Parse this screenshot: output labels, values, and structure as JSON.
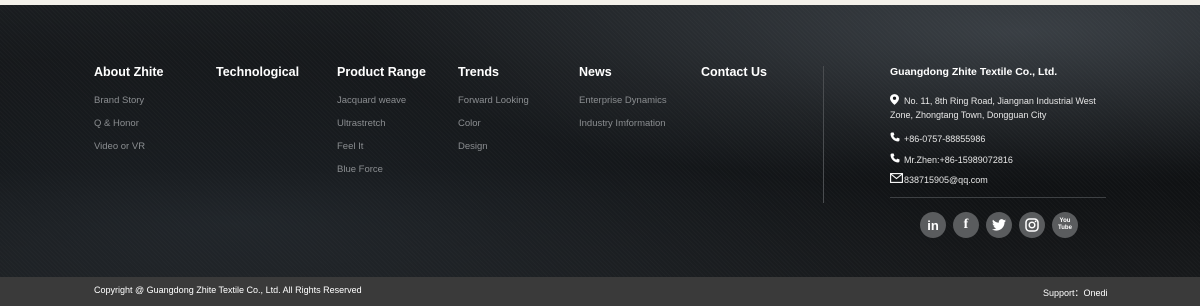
{
  "columns": [
    {
      "title": "About Zhite",
      "items": [
        "Brand Story",
        "Q & Honor",
        "Video or VR"
      ]
    },
    {
      "title": "Technological",
      "items": []
    },
    {
      "title": "Product Range",
      "items": [
        "Jacquard weave",
        "Ultrastretch",
        "Feel It",
        "Blue Force"
      ]
    },
    {
      "title": "Trends",
      "items": [
        "Forward Looking",
        "Color",
        "Design"
      ]
    },
    {
      "title": "News",
      "items": [
        "Enterprise Dynamics",
        "Industry Imformation"
      ]
    },
    {
      "title": "Contact Us",
      "items": []
    }
  ],
  "company": {
    "name": "Guangdong Zhite Textile Co., Ltd.",
    "address": "No. 11, 8th Ring Road, Jiangnan Industrial West",
    "address_line2": "Zone, Zhongtang Town, Dongguan City",
    "phone": "+86-0757-88855986",
    "mobile": "Mr.Zhen:+86-15989072816",
    "email": "838715905@qq.com"
  },
  "socials": [
    "in",
    "f",
    "twitter",
    "instagram",
    "You Tube"
  ],
  "footer_bar": {
    "copyright": "Copyright @ Guangdong Zhite Textile Co., Ltd. All Rights Reserved",
    "support": "Support：Onedi"
  }
}
